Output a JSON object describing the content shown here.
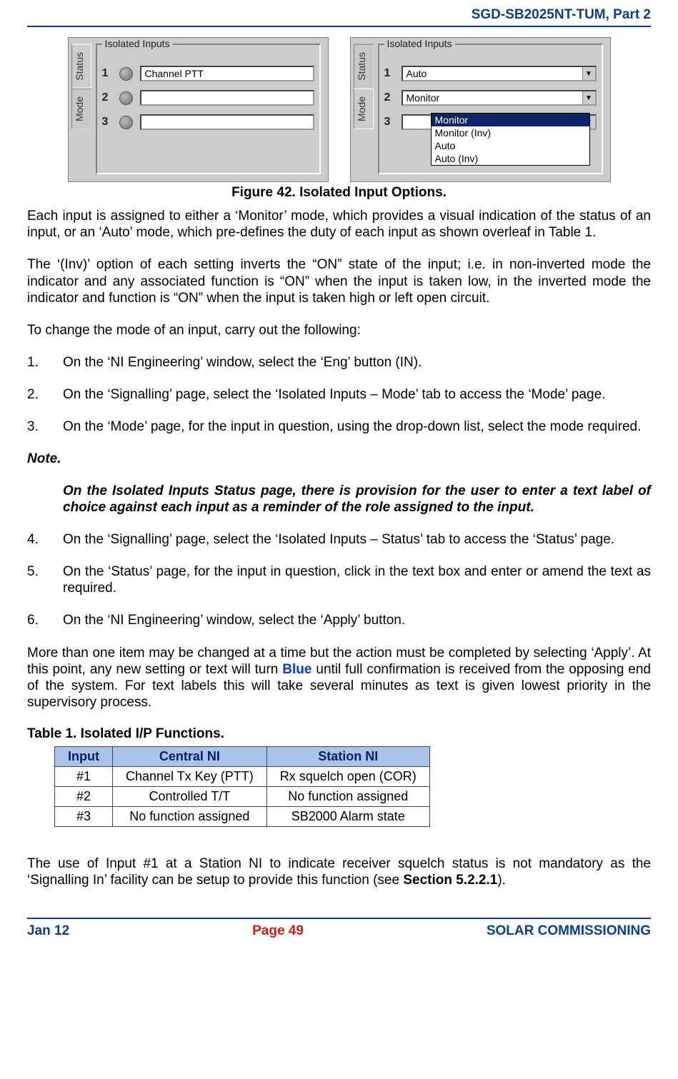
{
  "header": {
    "doc_id": "SGD-SB2025NT-TUM, Part 2"
  },
  "figure": {
    "caption": "Figure 42.  Isolated Input Options.",
    "tabs": {
      "status": "Status",
      "mode": "Mode"
    },
    "group_label": "Isolated Inputs",
    "left": {
      "rows": [
        {
          "n": "1",
          "value": "Channel PTT"
        },
        {
          "n": "2",
          "value": ""
        },
        {
          "n": "3",
          "value": ""
        }
      ]
    },
    "right": {
      "rows": [
        {
          "n": "1",
          "value": "Auto"
        },
        {
          "n": "2",
          "value": "Monitor"
        },
        {
          "n": "3",
          "value": ""
        }
      ],
      "dropdown": {
        "selected": "Monitor",
        "options": [
          "Monitor",
          "Monitor (Inv)",
          "Auto",
          "Auto (Inv)"
        ]
      }
    }
  },
  "paras": {
    "p1": "Each input is assigned to either a ‘Monitor’ mode, which provides a visual indication of the status of an input, or an ‘Auto’ mode, which pre-defines the duty of each input as shown overleaf in Table 1.",
    "p2": "The ‘(Inv)’ option of each setting inverts the “ON” state of the input; i.e. in non-inverted mode the indicator and any associated function is “ON” when the input is taken low, in the inverted mode the indicator and function is “ON” when the input is taken high or left open circuit.",
    "p3": "To change the mode of an input, carry out the following:",
    "note_head": "Note.",
    "note_body": "On the Isolated Inputs Status page, there is provision for the user to enter a text label of choice against each input as a reminder of the role assigned to the input.",
    "p_more_a": "More than one item may be changed at a time but the action must be completed by selecting ‘Apply’.  At this point, any new setting or text will turn ",
    "p_more_blue": "Blue",
    "p_more_b": " until full confirmation is received from the opposing end of the system.  For text labels this will take several minutes as text is given lowest priority in the supervisory process.",
    "table_caption": "Table 1.  Isolated I/P Functions.",
    "p_last_a": "The use of Input #1 at a Station NI to indicate receiver squelch status is not mandatory as the ‘Signalling In’ facility can be setup to provide this function (see ",
    "p_last_b": "Section 5.2.2.1",
    "p_last_c": ")."
  },
  "steps_a": [
    "On the ‘NI Engineering’ window, select the ‘Eng’ button (IN).",
    "On the ‘Signalling’ page, select the ‘Isolated Inputs – Mode’ tab to access the ‘Mode’ page.",
    "On the ‘Mode’ page, for the input in question, using the drop-down list, select the mode required."
  ],
  "steps_b": [
    "On the ‘Signalling’ page, select the ‘Isolated Inputs – Status’ tab to access the ‘Status’ page.",
    "On the ‘Status’ page, for the input in question, click in the text box and enter or amend the text as required.",
    "On the ‘NI Engineering’ window, select the ‘Apply’ button."
  ],
  "table": {
    "headers": [
      "Input",
      "Central NI",
      "Station NI"
    ],
    "rows": [
      [
        "#1",
        "Channel Tx Key (PTT)",
        "Rx squelch open (COR)"
      ],
      [
        "#2",
        "Controlled T/T",
        "No function assigned"
      ],
      [
        "#3",
        "No function assigned",
        "SB2000 Alarm state"
      ]
    ]
  },
  "footer": {
    "date": "Jan 12",
    "page": "Page 49",
    "section": "SOLAR COMMISSIONING"
  }
}
